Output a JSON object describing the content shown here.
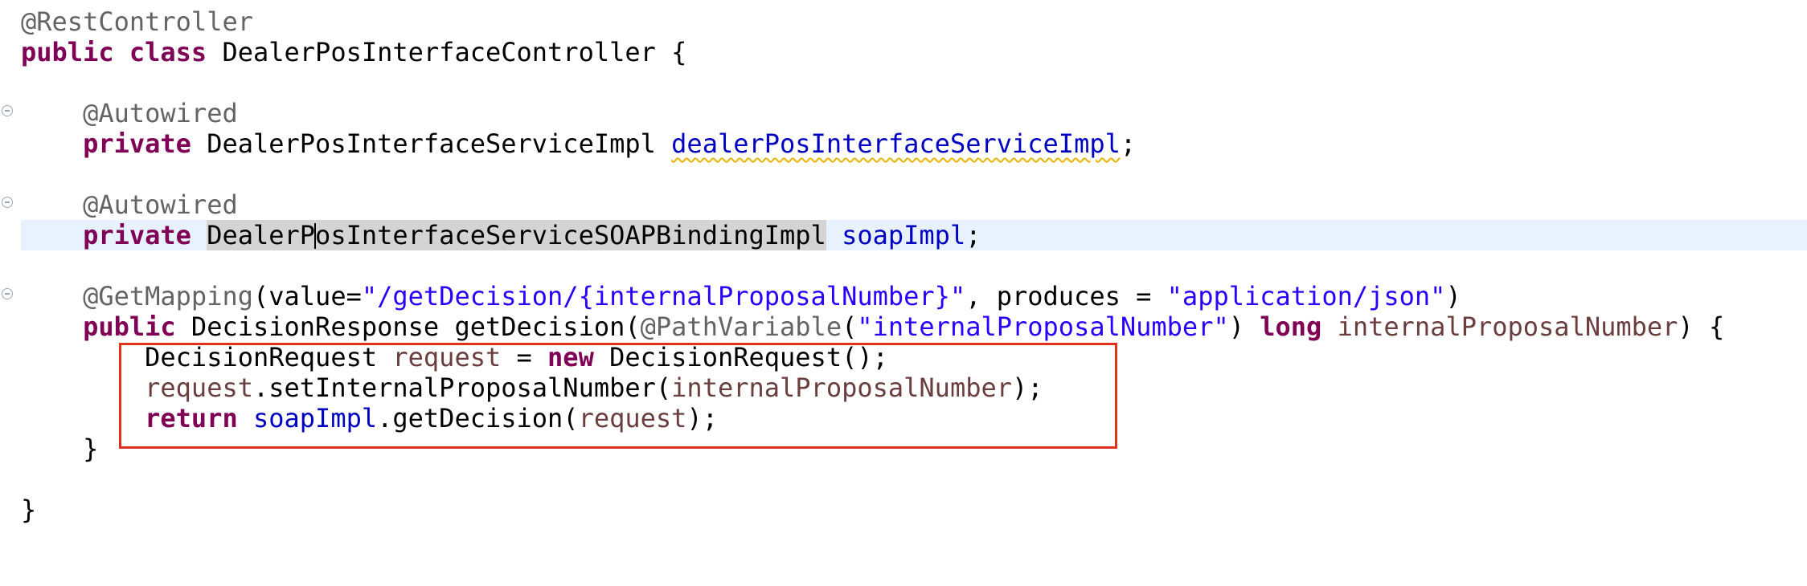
{
  "editor": {
    "language": "java",
    "colors": {
      "keyword": "#7f0055",
      "annotation": "#646464",
      "string": "#2a00ff",
      "field": "#0000c0",
      "local_variable": "#6a3e3e",
      "current_line": "#e8f2fe",
      "occurrence_highlight": "#d4d4d4",
      "warning_underline": "#e8b400",
      "highlight_box": "#e0301e"
    },
    "fold_icon": "collapse-circle-icon",
    "lines": {
      "l1": {
        "a": "@RestController"
      },
      "l2": {
        "kw1": "public",
        "kw2": "class",
        "name": "DealerPosInterfaceController",
        "brace": "{"
      },
      "l4": {
        "ann": "@Autowired"
      },
      "l5": {
        "kw": "private",
        "type": "DealerPosInterfaceServiceImpl",
        "field": "dealerPosInterfaceServiceImpl",
        "end": ";"
      },
      "l7": {
        "ann": "@Autowired"
      },
      "l8": {
        "kw": "private",
        "type_before_caret": "DealerP",
        "type_after_caret": "osInterfaceServiceSOAPBindingImpl",
        "field": "soapImpl",
        "end": ";"
      },
      "l10": {
        "ann": "@GetMapping",
        "p1": "(value=",
        "s1": "\"/getDecision/{internalProposalNumber}\"",
        "p2": ", produces = ",
        "s2": "\"application/json\"",
        "p3": ")"
      },
      "l11": {
        "kw": "public",
        "t1": "DecisionResponse getDecision(",
        "ann": "@PathVariable",
        "p1": "(",
        "s1": "\"internalProposalNumber\"",
        "p2": ") ",
        "kw2": "long",
        "param": "internalProposalNumber",
        "p3": ") {"
      },
      "l12": {
        "t1": "DecisionRequest ",
        "var": "request",
        "t2": " = ",
        "kw": "new",
        "t3": " DecisionRequest();"
      },
      "l13": {
        "var": "request",
        "t1": ".setInternalProposalNumber(",
        "param": "internalProposalNumber",
        "t2": ");"
      },
      "l14": {
        "kw": "return",
        "field": "soapImpl",
        "t1": ".getDecision(",
        "var": "request",
        "t2": ");"
      },
      "l15": {
        "brace": "}"
      },
      "l17": {
        "brace": "}"
      }
    }
  }
}
